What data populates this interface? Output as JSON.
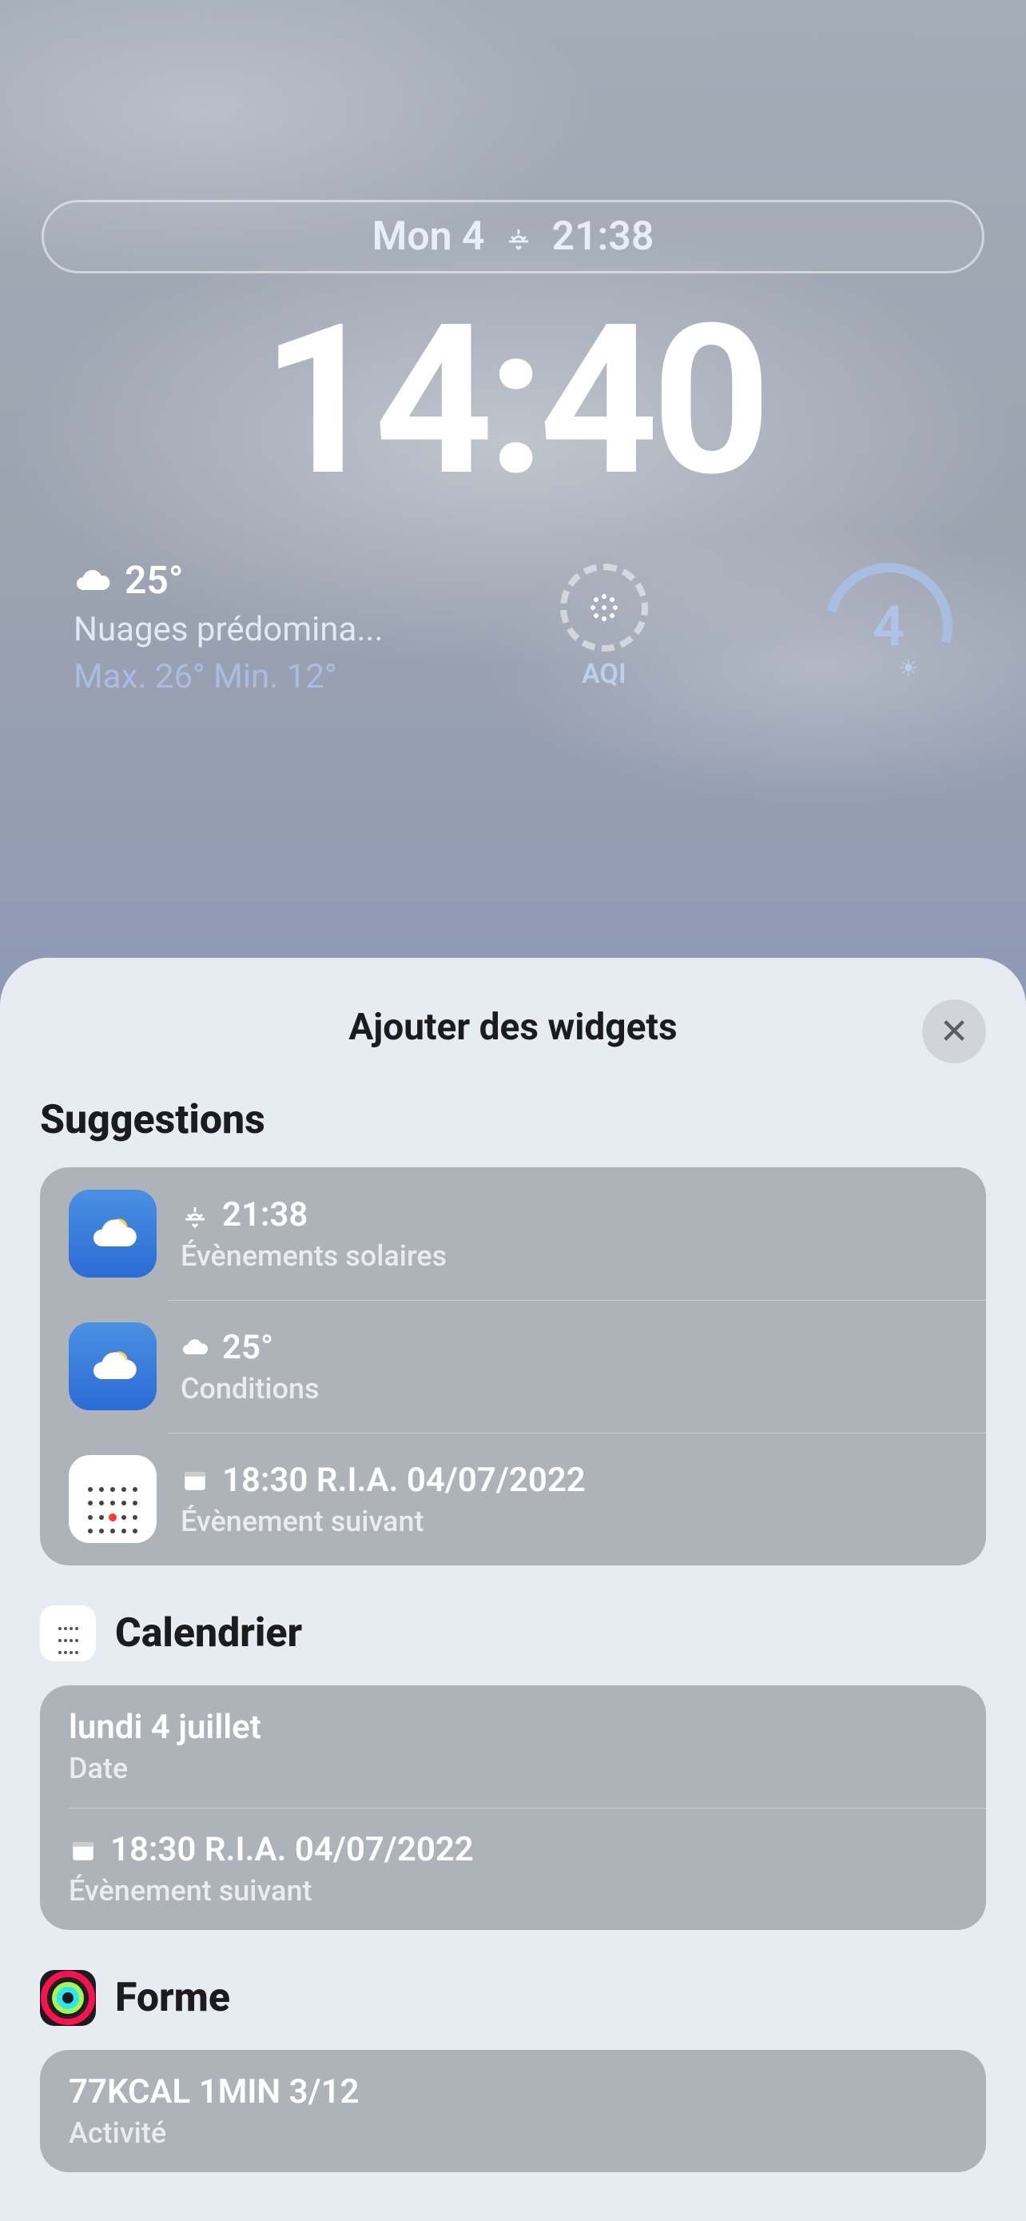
{
  "lockscreen": {
    "date_label": "Mon 4",
    "sunset_time": "21:38",
    "clock": "14:40"
  },
  "weather": {
    "temp": "25°",
    "condition": "Nuages prédomina...",
    "hi_lo": "Max. 26° Min. 12°",
    "aqi_label": "AQI",
    "uv": "4"
  },
  "sheet": {
    "title": "Ajouter des widgets",
    "close_name": "close"
  },
  "suggestions": {
    "header": "Suggestions",
    "items": [
      {
        "title": "21:38",
        "subtitle": "Évènements solaires",
        "icon": "weather"
      },
      {
        "title": "25°",
        "subtitle": "Conditions",
        "icon": "weather"
      },
      {
        "title": "18:30 R.I.A. 04/07/2022",
        "subtitle": "Évènement suivant",
        "icon": "calendar"
      }
    ]
  },
  "calendar": {
    "header": "Calendrier",
    "items": [
      {
        "title": "lundi 4 juillet",
        "subtitle": "Date"
      },
      {
        "title": "18:30 R.I.A. 04/07/2022",
        "subtitle": "Évènement suivant"
      }
    ]
  },
  "fitness": {
    "header": "Forme",
    "items": [
      {
        "title": "77KCAL 1MIN 3/12",
        "subtitle": "Activité"
      }
    ]
  }
}
